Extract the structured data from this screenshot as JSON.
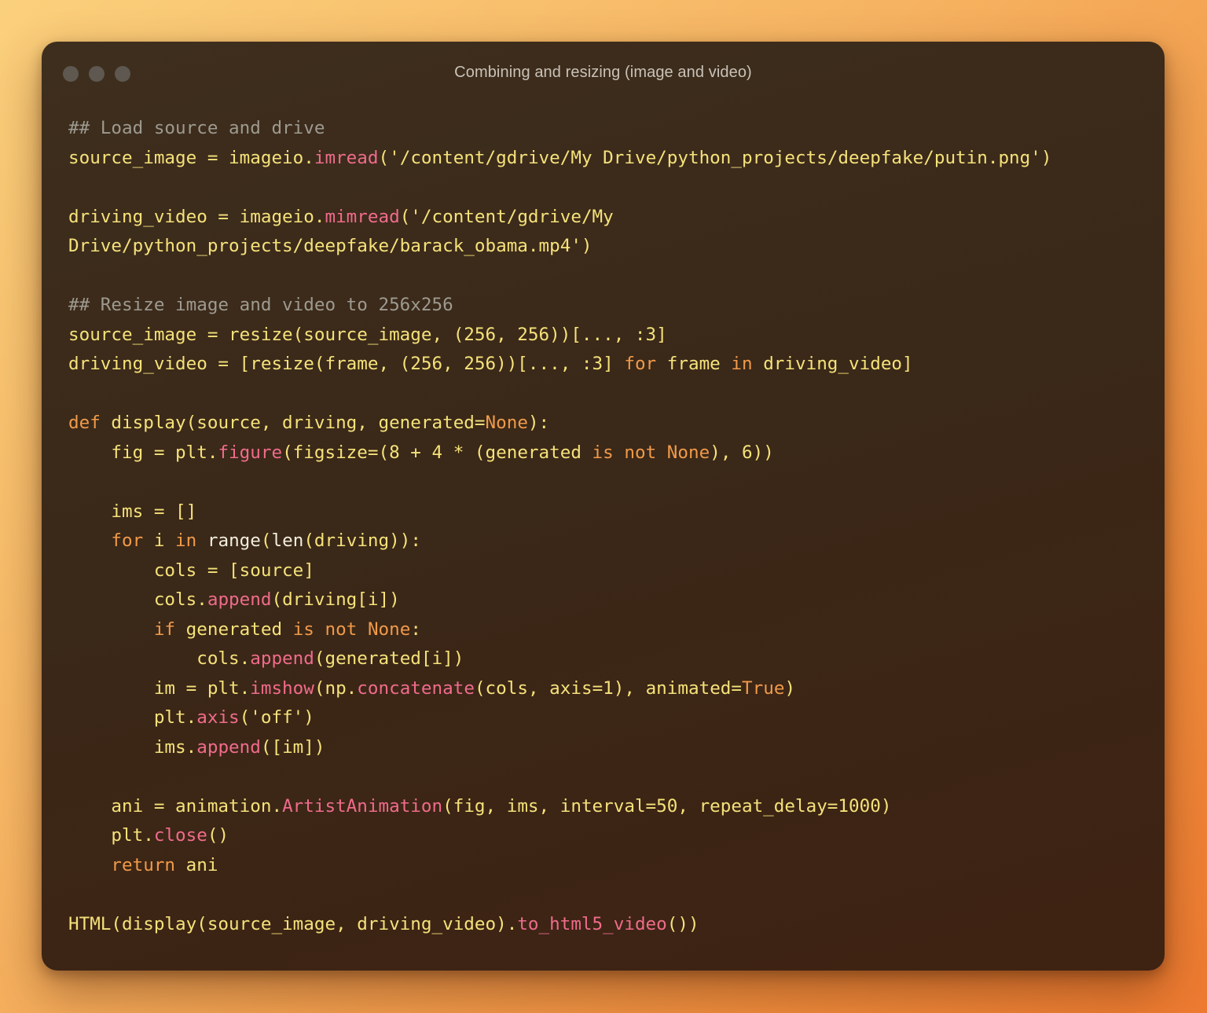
{
  "window": {
    "title": "Combining and resizing (image and video)",
    "controls": [
      "close-dot",
      "minimize-dot",
      "maximize-dot"
    ]
  },
  "colors": {
    "background_start": "#fbd07c",
    "background_end": "#ee7a30",
    "window_bg": "#3a2818",
    "default_code": "#f5e27a",
    "comment": "#9d9a90",
    "keyword": "#f09a4a",
    "method": "#f06b8c",
    "builtin": "#f3eee0"
  },
  "code": {
    "lines": [
      "## Load source and drive",
      "source_image = imageio.imread('/content/gdrive/My Drive/python_projects/deepfake/putin.png')",
      "",
      "driving_video = imageio.mimread('/content/gdrive/My",
      "Drive/python_projects/deepfake/barack_obama.mp4')",
      "",
      "## Resize image and video to 256x256",
      "source_image = resize(source_image, (256, 256))[..., :3]",
      "driving_video = [resize(frame, (256, 256))[..., :3] for frame in driving_video]",
      "",
      "def display(source, driving, generated=None):",
      "    fig = plt.figure(figsize=(8 + 4 * (generated is not None), 6))",
      "",
      "    ims = []",
      "    for i in range(len(driving)):",
      "        cols = [source]",
      "        cols.append(driving[i])",
      "        if generated is not None:",
      "            cols.append(generated[i])",
      "        im = plt.imshow(np.concatenate(cols, axis=1), animated=True)",
      "        plt.axis('off')",
      "        ims.append([im])",
      "",
      "    ani = animation.ArtistAnimation(fig, ims, interval=50, repeat_delay=1000)",
      "    plt.close()",
      "    return ani",
      "",
      "HTML(display(source_image, driving_video).to_html5_video())"
    ]
  }
}
